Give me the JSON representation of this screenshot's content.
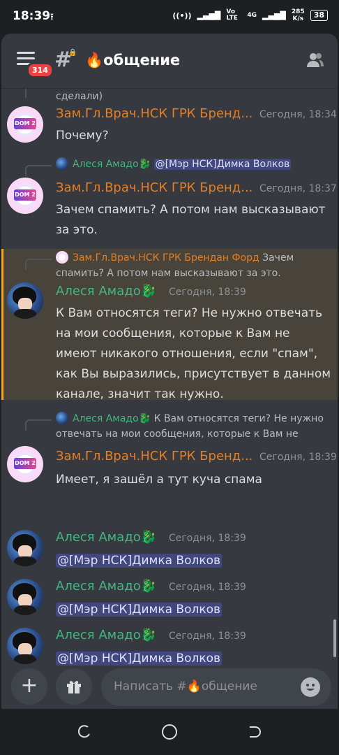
{
  "status": {
    "time": "18:39",
    "net_lte": "Vo LTE",
    "net_4g": "4G",
    "speed_value": "285",
    "speed_unit": "K/s",
    "battery": "38"
  },
  "header": {
    "unread_badge": "314",
    "channel_emoji": "🔥",
    "channel_name": "общение"
  },
  "messages": [
    {
      "type": "continued",
      "text": "сделали)"
    },
    {
      "author": "Зам.Гл.Врач.НСК ГРК Бренд...",
      "time": "Сегодня, 18:34",
      "text": "Почему?"
    },
    {
      "reply": {
        "author": "Алеся Амадо🐉",
        "text": "@[Мэр НСК]Димка Волков"
      },
      "author": "Зам.Гл.Врач.НСК ГРК Бренд...",
      "time": "Сегодня, 18:37",
      "text": "Зачем спамить? А потом нам высказывают за это."
    },
    {
      "reply": {
        "author": "Зам.Гл.Врач.НСК ГРК Брендан Форд",
        "text": "Зачем спамить? А потом нам высказывают за это."
      },
      "author": "Алеся Амадо🐉",
      "time": "Сегодня, 18:39",
      "text": "К Вам относятся теги? Не нужно отвечать на мои сообщения, которые к Вам не имеют никакого отношения, если \"спам\", как Вы выразились, присутствует в данном канале, значит так нужно."
    },
    {
      "reply": {
        "author": "Алеся Амадо🐉",
        "text": "К Вам относятся теги? Не нужно отвечать на мои сообщения, которые к Вам не имеют"
      },
      "author": "Зам.Гл.Врач.НСК ГРК Бренд...",
      "time": "Сегодня, 18:39",
      "text": "Имеет, я зашёл а тут куча спама"
    },
    {
      "author": "Алеся Амадо🐉",
      "time": "Сегодня, 18:39",
      "text": "@[Мэр НСК]Димка Волков"
    },
    {
      "author": "Алеся Амадо🐉",
      "time": "Сегодня, 18:39",
      "text": "@[Мэр НСК]Димка Волков"
    },
    {
      "author": "Алеся Амадо🐉",
      "time": "Сегодня, 18:39",
      "text": "@[Мэр НСК]Димка Волков"
    }
  ],
  "composer": {
    "placeholder": "Написать #🔥общение"
  },
  "avatar_logo_text": "DOM 2",
  "icons": {
    "menu": "hamburger-icon",
    "channel": "hashtag-lock-icon",
    "members": "members-icon",
    "add": "plus-icon",
    "gift": "gift-icon",
    "emoji": "emoji-icon"
  },
  "colors": {
    "background": "#36393f",
    "orange_role": "#e67e22",
    "green_role": "#43b581",
    "mention_bg": "#5865f2",
    "highlight": "#faa81a"
  }
}
